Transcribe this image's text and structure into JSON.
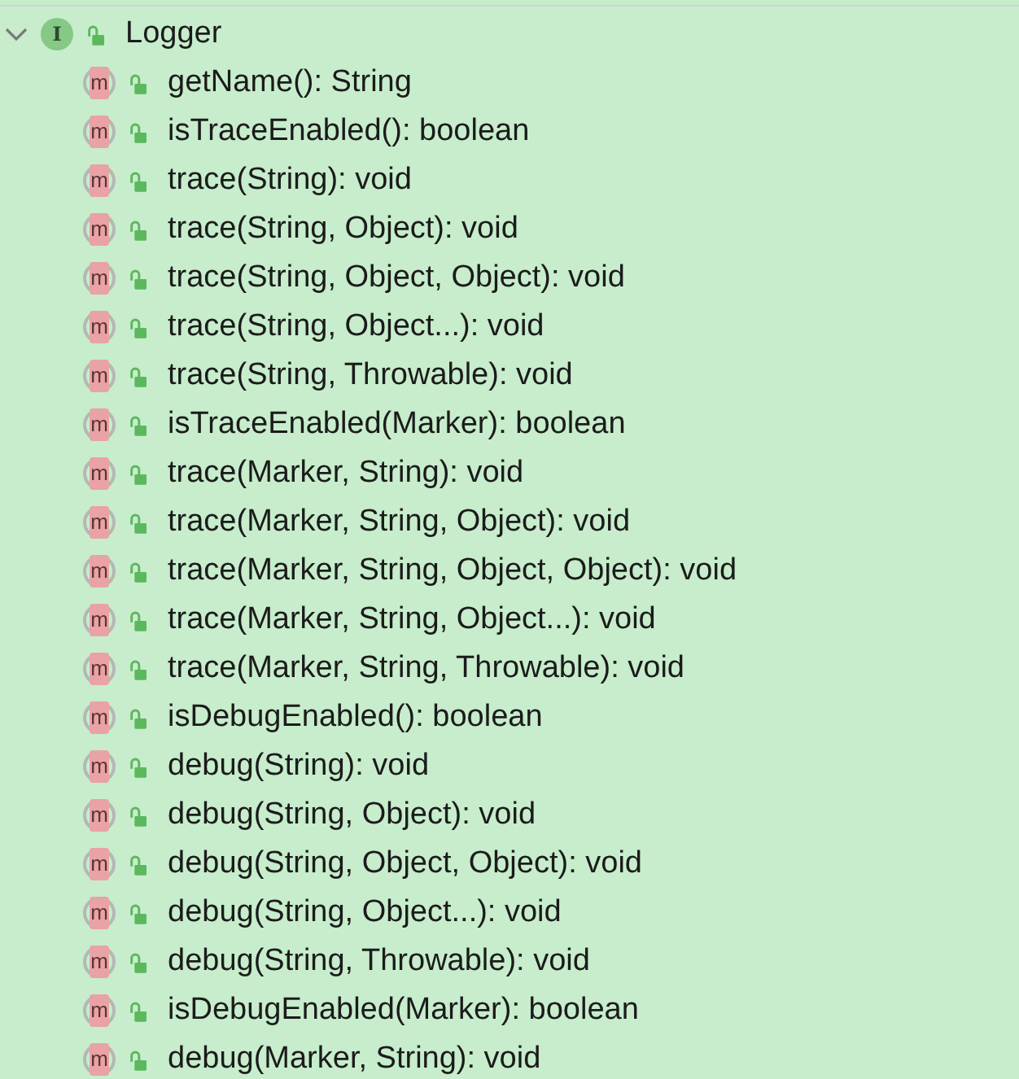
{
  "tree": {
    "label": "Logger",
    "kind": "interface",
    "icon_letter": "I",
    "expanded": true,
    "children": [
      {
        "label": "getName(): String",
        "kind": "method",
        "icon_letter": "m"
      },
      {
        "label": "isTraceEnabled(): boolean",
        "kind": "method",
        "icon_letter": "m"
      },
      {
        "label": "trace(String): void",
        "kind": "method",
        "icon_letter": "m"
      },
      {
        "label": "trace(String, Object): void",
        "kind": "method",
        "icon_letter": "m"
      },
      {
        "label": "trace(String, Object, Object): void",
        "kind": "method",
        "icon_letter": "m"
      },
      {
        "label": "trace(String, Object...): void",
        "kind": "method",
        "icon_letter": "m"
      },
      {
        "label": "trace(String, Throwable): void",
        "kind": "method",
        "icon_letter": "m"
      },
      {
        "label": "isTraceEnabled(Marker): boolean",
        "kind": "method",
        "icon_letter": "m"
      },
      {
        "label": "trace(Marker, String): void",
        "kind": "method",
        "icon_letter": "m"
      },
      {
        "label": "trace(Marker, String, Object): void",
        "kind": "method",
        "icon_letter": "m"
      },
      {
        "label": "trace(Marker, String, Object, Object): void",
        "kind": "method",
        "icon_letter": "m"
      },
      {
        "label": "trace(Marker, String, Object...): void",
        "kind": "method",
        "icon_letter": "m"
      },
      {
        "label": "trace(Marker, String, Throwable): void",
        "kind": "method",
        "icon_letter": "m"
      },
      {
        "label": "isDebugEnabled(): boolean",
        "kind": "method",
        "icon_letter": "m"
      },
      {
        "label": "debug(String): void",
        "kind": "method",
        "icon_letter": "m"
      },
      {
        "label": "debug(String, Object): void",
        "kind": "method",
        "icon_letter": "m"
      },
      {
        "label": "debug(String, Object, Object): void",
        "kind": "method",
        "icon_letter": "m"
      },
      {
        "label": "debug(String, Object...): void",
        "kind": "method",
        "icon_letter": "m"
      },
      {
        "label": "debug(String, Throwable): void",
        "kind": "method",
        "icon_letter": "m"
      },
      {
        "label": "isDebugEnabled(Marker): boolean",
        "kind": "method",
        "icon_letter": "m"
      },
      {
        "label": "debug(Marker, String): void",
        "kind": "method",
        "icon_letter": "m"
      }
    ]
  }
}
